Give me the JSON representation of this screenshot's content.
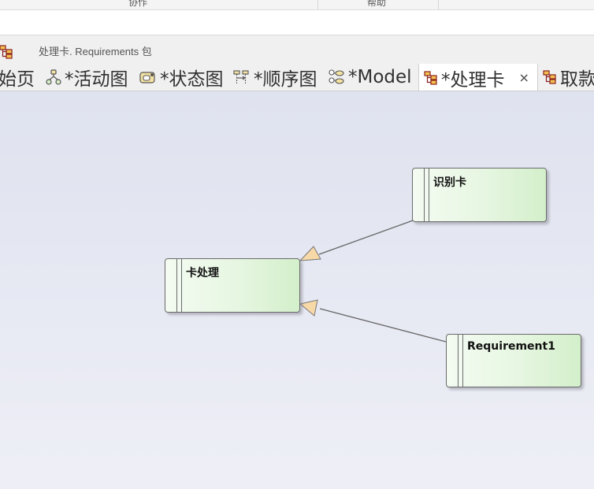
{
  "ribbon": {
    "labels": [
      "协作",
      "帮助"
    ]
  },
  "breadcrumb": {
    "text": "处理卡.  Requirements 包"
  },
  "tabs": [
    {
      "label": "始页",
      "icon": "start-page-icon"
    },
    {
      "label": "*活动图",
      "icon": "activity-diagram-icon"
    },
    {
      "label": "*状态图",
      "icon": "state-diagram-icon"
    },
    {
      "label": "*顺序图",
      "icon": "sequence-diagram-icon"
    },
    {
      "label": "*Model",
      "icon": "model-diagram-icon"
    },
    {
      "label": "*处理卡",
      "icon": "requirements-diagram-icon",
      "active": true,
      "close": "×"
    },
    {
      "label": "取款",
      "icon": "requirements-diagram-icon"
    }
  ],
  "diagram": {
    "nodes": [
      {
        "id": "card-handling",
        "label": "卡处理"
      },
      {
        "id": "identify-card",
        "label": "识别卡"
      },
      {
        "id": "requirement1",
        "label": "Requirement1"
      }
    ],
    "connectors": [
      {
        "from": "identify-card",
        "to": "card-handling",
        "type": "generalization"
      },
      {
        "from": "requirement1",
        "to": "card-handling",
        "type": "generalization"
      }
    ]
  },
  "colors": {
    "node_fill_start": "#f4fbf2",
    "node_fill_end": "#d3efca",
    "arrowhead": "#f7d8a7",
    "connector": "#666666",
    "canvas": "#e3e5f0"
  }
}
